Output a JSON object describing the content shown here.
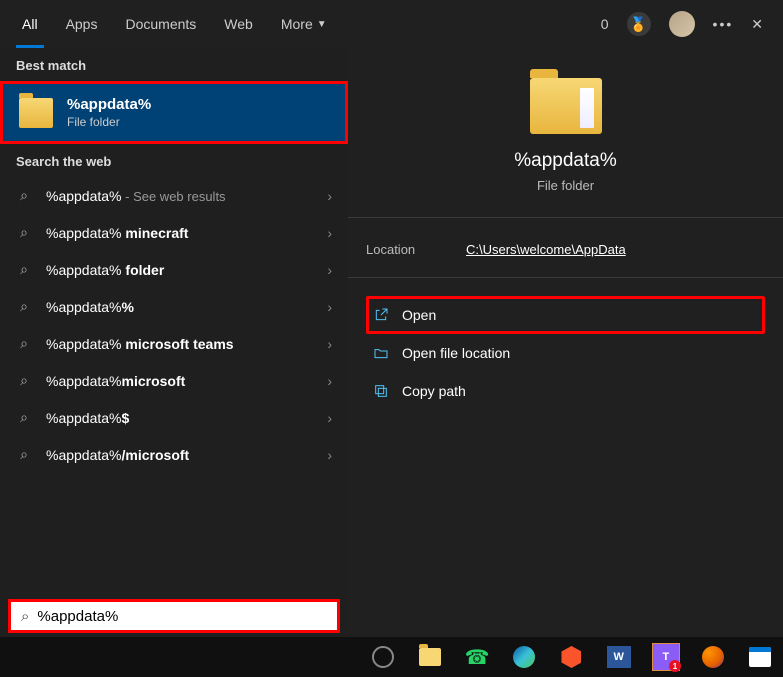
{
  "topbar": {
    "tabs": [
      "All",
      "Apps",
      "Documents",
      "Web",
      "More"
    ],
    "active_tab": 0,
    "zero": "0"
  },
  "left": {
    "best_match_label": "Best match",
    "best_match": {
      "title": "%appdata%",
      "subtitle": "File folder"
    },
    "search_web_label": "Search the web",
    "web_results": [
      {
        "prefix": "%appdata%",
        "suffix": "",
        "tail": " - See web results"
      },
      {
        "prefix": "%appdata% ",
        "suffix": "minecraft",
        "tail": ""
      },
      {
        "prefix": "%appdata% ",
        "suffix": "folder",
        "tail": ""
      },
      {
        "prefix": "%appdata%",
        "suffix": "%",
        "tail": ""
      },
      {
        "prefix": "%appdata% ",
        "suffix": "microsoft teams",
        "tail": ""
      },
      {
        "prefix": "%appdata%",
        "suffix": "microsoft",
        "tail": ""
      },
      {
        "prefix": "%appdata%",
        "suffix": "$",
        "tail": ""
      },
      {
        "prefix": "%appdata%",
        "suffix": "/microsoft",
        "tail": ""
      }
    ]
  },
  "right": {
    "title": "%appdata%",
    "subtitle": "File folder",
    "location_label": "Location",
    "location_value": "C:\\Users\\welcome\\AppData",
    "actions": {
      "open": "Open",
      "open_loc": "Open file location",
      "copy_path": "Copy path"
    }
  },
  "search": {
    "value": "%appdata%"
  }
}
